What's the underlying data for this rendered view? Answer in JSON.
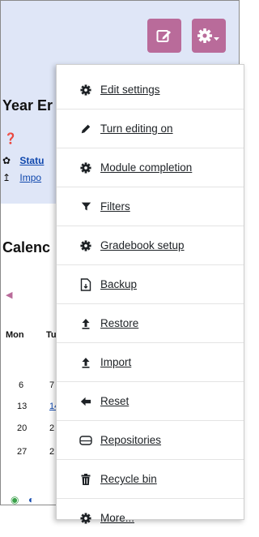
{
  "background": {
    "heading_fragment": "Year Er",
    "status_fragment": "Statu",
    "import_fragment": "Impo",
    "calendar_fragment": "Calenc",
    "weekdays": [
      "Mon",
      "Tu"
    ],
    "calendar_rows": [
      [
        "6",
        "7"
      ],
      [
        "13",
        "14"
      ],
      [
        "20",
        "2"
      ],
      [
        "27",
        "2"
      ]
    ]
  },
  "toolbar": {
    "edit_button_icon": "edit-icon",
    "settings_button_icon": "gear-dropdown-icon",
    "button_color": "#b96b9a"
  },
  "menu": {
    "items": [
      {
        "label": "Edit settings",
        "icon": "gear-icon"
      },
      {
        "label": "Turn editing on",
        "icon": "pencil-icon"
      },
      {
        "label": "Module completion",
        "icon": "gear-icon"
      },
      {
        "label": "Filters",
        "icon": "filter-icon"
      },
      {
        "label": "Gradebook setup",
        "icon": "gear-icon"
      },
      {
        "label": "Backup",
        "icon": "backup-file-icon"
      },
      {
        "label": "Restore",
        "icon": "upload-arrow-icon"
      },
      {
        "label": "Import",
        "icon": "upload-arrow-icon"
      },
      {
        "label": "Reset",
        "icon": "arrow-left-icon"
      },
      {
        "label": "Repositories",
        "icon": "drive-icon"
      },
      {
        "label": "Recycle bin",
        "icon": "trash-icon"
      },
      {
        "label": "More...",
        "icon": "gear-icon"
      }
    ]
  }
}
